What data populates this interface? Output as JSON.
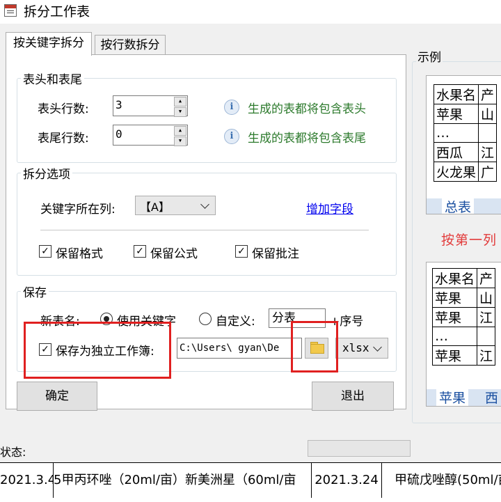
{
  "window": {
    "title": "拆分工作表"
  },
  "tabs": [
    {
      "label": "按关键字拆分",
      "active": true
    },
    {
      "label": "按行数拆分",
      "active": false
    }
  ],
  "header_footer": {
    "group_label": "表头和表尾",
    "header_rows_label": "表头行数:",
    "header_rows_value": "3",
    "header_hint": "生成的表都将包含表头",
    "footer_rows_label": "表尾行数:",
    "footer_rows_value": "0",
    "footer_hint": "生成的表都将包含表尾"
  },
  "split_options": {
    "group_label": "拆分选项",
    "key_column_label": "关键字所在列:",
    "key_column_value": "【A】",
    "add_field_link": "增加字段",
    "keep_format": {
      "label": "保留格式",
      "checked": true
    },
    "keep_formula": {
      "label": "保留公式",
      "checked": true
    },
    "keep_comment": {
      "label": "保留批注",
      "checked": true
    }
  },
  "save": {
    "group_label": "保存",
    "new_name_label": "新表名:",
    "use_keyword_label": "使用关键字",
    "custom_label": "自定义:",
    "custom_value": "分表",
    "seq_suffix": "+序号",
    "independent_label": "保存为独立工作簿:",
    "independent_checked": true,
    "path_value": "C:\\Users\\      gyan\\De",
    "format_value": "xlsx"
  },
  "buttons": {
    "ok": "确定",
    "exit": "退出"
  },
  "example": {
    "group_label": "示例",
    "top_table": [
      [
        "水果名",
        "产"
      ],
      [
        "苹果",
        "山"
      ],
      [
        "…",
        ""
      ],
      [
        "西瓜",
        "江"
      ],
      [
        "火龙果",
        "广"
      ]
    ],
    "top_sheet_tab": "总表",
    "caption": "按第一列",
    "bottom_table": [
      [
        "水果名",
        "产"
      ],
      [
        "苹果",
        "山"
      ],
      [
        "苹果",
        "江"
      ],
      [
        "…",
        ""
      ],
      [
        "苹果",
        "江"
      ]
    ],
    "bottom_sheet_tabs": [
      "苹果",
      "西"
    ]
  },
  "status": {
    "label": "状态:"
  },
  "background_sheet": {
    "cells": [
      "2021.3.4",
      "5甲丙环唑（20ml/亩）新美洲星（60ml/亩",
      "2021.3.24",
      "甲硫戊唑醇(50ml/亩"
    ]
  },
  "colors": {
    "hint_green": "#2c7a2c",
    "link_blue": "#0000ee",
    "highlight_red": "#e02020",
    "example_red": "#e23b3b"
  }
}
